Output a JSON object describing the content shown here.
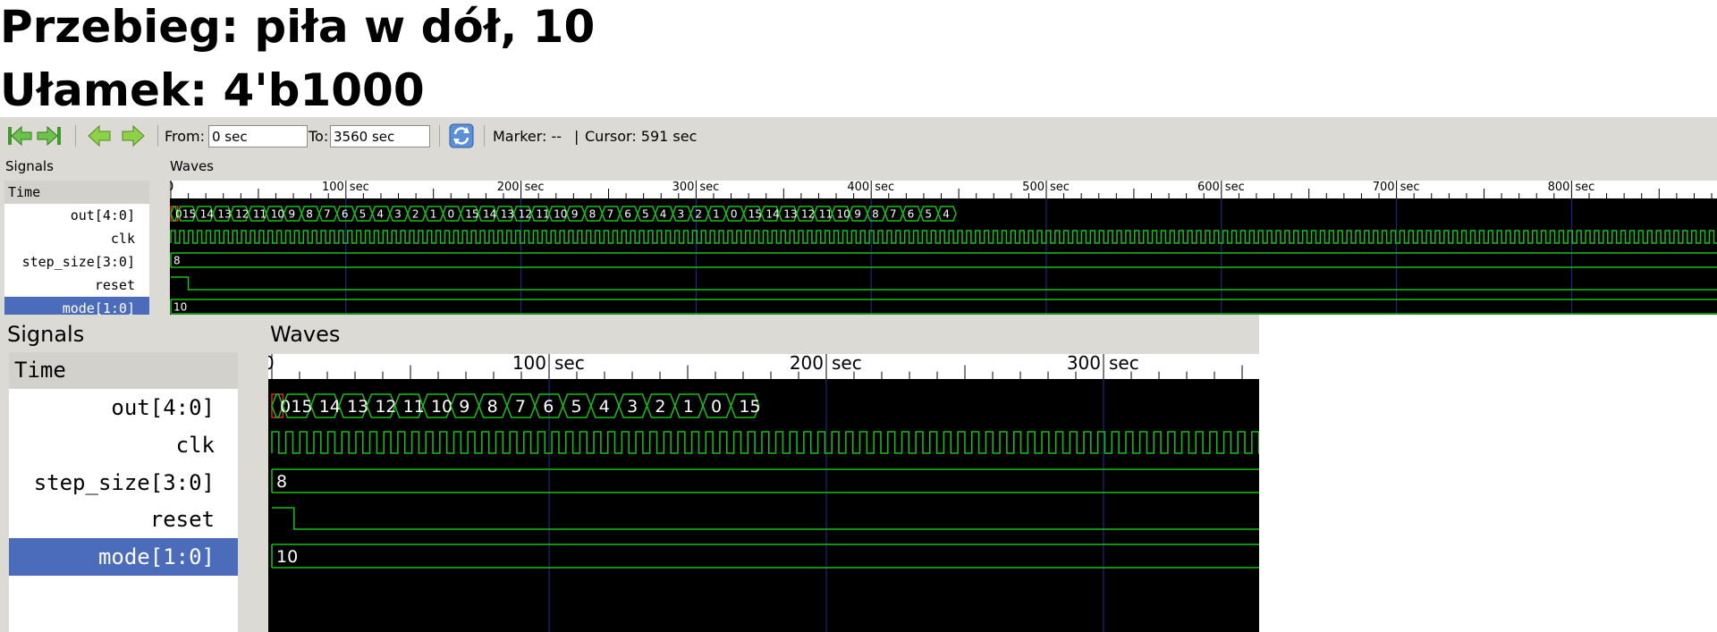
{
  "headings": {
    "line1": "Przebieg: piła w dół, 10",
    "line2": "Ułamek: 4'b1000"
  },
  "toolbar": {
    "icons": [
      "jump-to-start-icon",
      "jump-to-end-icon",
      "zoom-back-icon",
      "zoom-forward-icon",
      "reload-icon"
    ],
    "from_label": "From:",
    "from_value": "0 sec",
    "to_label": "To:",
    "to_value": "3560 sec",
    "marker_text": "Marker: --",
    "cursor_text": "Cursor: 591 sec"
  },
  "signals_label": "Signals",
  "waves_label": "Waves",
  "signals": [
    "Time",
    "out[4:0]",
    "clk",
    "step_size[3:0]",
    "reset",
    "mode[1:0]"
  ],
  "selected_signal": "mode[1:0]",
  "time_unit": "sec",
  "small_view": {
    "time_labels": [
      "100",
      "200",
      "300",
      "400",
      "500",
      "600",
      "700",
      "800"
    ],
    "out_values": [
      "0",
      "15",
      "14",
      "13",
      "12",
      "11",
      "10",
      "9",
      "8",
      "7",
      "6",
      "5",
      "4",
      "3",
      "2",
      "1",
      "0",
      "15",
      "14",
      "13",
      "12",
      "11",
      "10",
      "9",
      "8",
      "7",
      "6",
      "5",
      "4",
      "3",
      "2",
      "1",
      "0",
      "15",
      "14",
      "13",
      "12",
      "11",
      "10",
      "9",
      "8",
      "7",
      "6",
      "5",
      "4"
    ],
    "step_size_value": "8",
    "mode_value": "10"
  },
  "big_view": {
    "time_labels": [
      "100",
      "200",
      "300"
    ],
    "out_values": [
      "0",
      "15",
      "14",
      "13",
      "12",
      "11",
      "10",
      "9",
      "8",
      "7",
      "6",
      "5",
      "4",
      "3",
      "2",
      "1",
      "0",
      "15"
    ],
    "step_size_value": "8",
    "mode_value": "10"
  },
  "colors": {
    "wave": "#19c019",
    "marker": "#e02020",
    "grid": "#2a2a9a",
    "selected_row": "#4a6cbb",
    "panel_bg": "#dcdad5"
  }
}
